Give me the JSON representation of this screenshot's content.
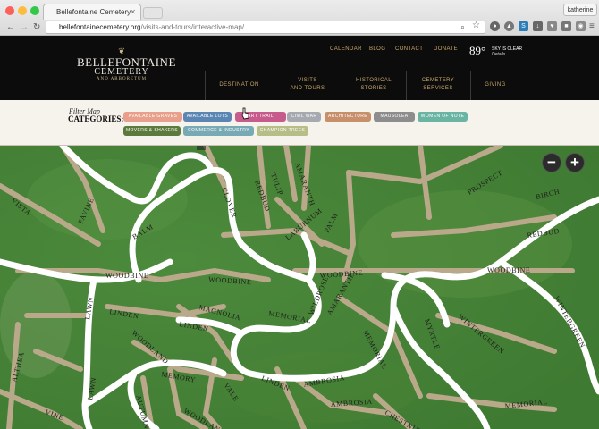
{
  "browser": {
    "tab_title": "Bellefontaine Cemetery",
    "user": "katherine",
    "url_domain": "bellefontainecemetery.org",
    "url_path": "/visits-and-tours/interactive-map/"
  },
  "logo": {
    "line1": "BELLEFONTAINE",
    "line2": "CEMETERY",
    "line3": "AND ARBORETUM"
  },
  "utility": [
    "CALENDAR",
    "BLOG",
    "CONTACT",
    "DONATE"
  ],
  "weather": {
    "temp": "89°",
    "condition": "SKY IS CLEAR",
    "details": "Details"
  },
  "nav": [
    {
      "label": "DESTINATION"
    },
    {
      "label": "VISITS\nAND TOURS"
    },
    {
      "label": "HISTORICAL\nSTORIES"
    },
    {
      "label": "CEMETERY\nSERVICES"
    },
    {
      "label": "GIVING"
    }
  ],
  "filter": {
    "title": "Filter Map",
    "subtitle": "CATEGORIES:",
    "pills": [
      {
        "label": "AVAILABLE GRAVES",
        "color": "#e8a08c"
      },
      {
        "label": "AVAILABLE LOTS",
        "color": "#5b86b4"
      },
      {
        "label": "ART TRAIL",
        "color": "#c75c8c"
      },
      {
        "label": "CIVIL WAR",
        "color": "#a6a9b0"
      },
      {
        "label": "ARCHITECTURE",
        "color": "#c8906a"
      },
      {
        "label": "MAUSOLEA",
        "color": "#8d8d8d"
      },
      {
        "label": "WOMEN OF NOTE",
        "color": "#6ab4a4"
      },
      {
        "label": "MOVERS & SHAKERS",
        "color": "#5c7a3c"
      },
      {
        "label": "COMMERCE & INDUSTRY",
        "color": "#78aab6"
      },
      {
        "label": "CHAMPION TREES",
        "color": "#b6bd86"
      }
    ]
  },
  "map": {
    "zoom_out": "−",
    "zoom_in": "+",
    "roads": [
      "VISTA",
      "FAVINE",
      "BALM",
      "CLOVER",
      "REDBUD",
      "TULIP",
      "AMARANTH",
      "PROSPECT",
      "BIRCH",
      "REDBUD",
      "LABURNUM",
      "PALM",
      "WOODBINE",
      "WOODBINE",
      "WOODBINE",
      "WOODBINE",
      "LAWN",
      "LINDEN",
      "LINDEN",
      "MAGNOLIA",
      "WOODLAND",
      "MEMORIAL",
      "WILDROSE",
      "AMARANTH",
      "MEMORIAL",
      "MYRTLE",
      "WINTERGREEN",
      "WINTERGREEN",
      "ALTHEA",
      "LAWN",
      "AUTUMN",
      "VINE",
      "MEMORY",
      "VALE",
      "WOODLAND",
      "LINDEN",
      "AMBROSIA",
      "AMBROSIA",
      "CHESTNUT",
      "MEMORIAL"
    ]
  }
}
